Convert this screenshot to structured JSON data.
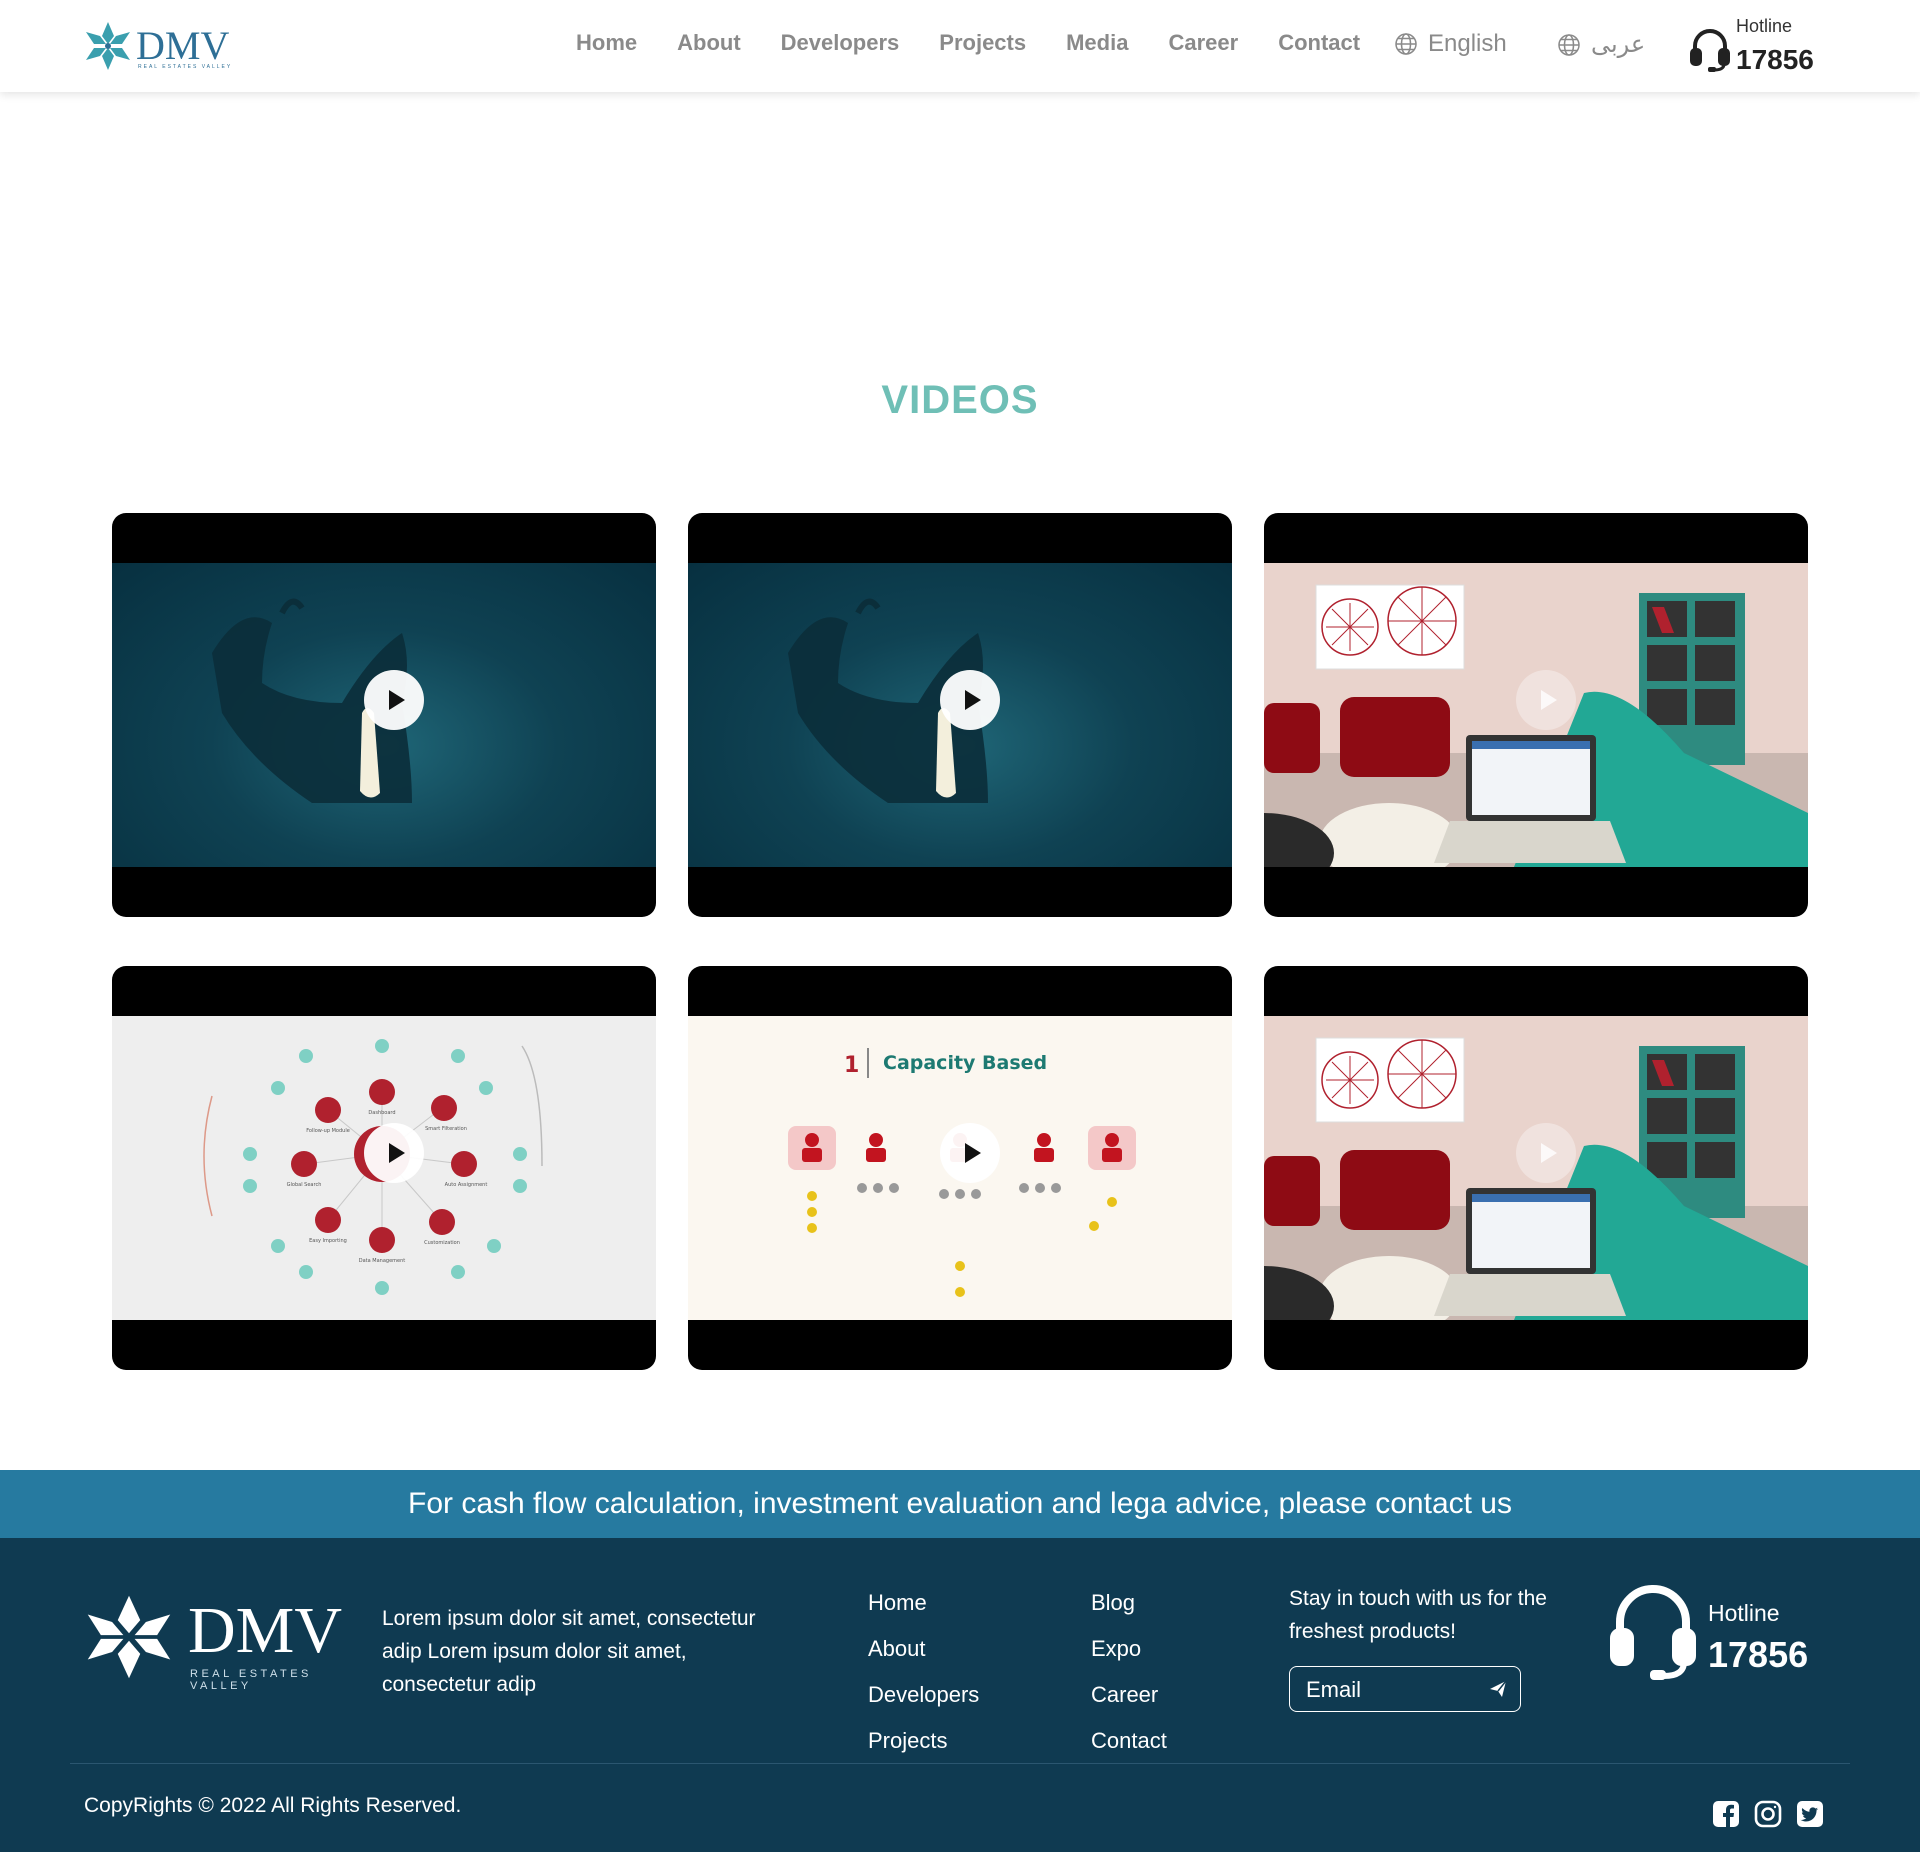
{
  "header": {
    "logo_text": "DMV",
    "logo_subtext": "REAL ESTATES VALLEY",
    "nav": [
      "Home",
      "About",
      "Developers",
      "Projects",
      "Media",
      "Career",
      "Contact"
    ],
    "lang_english": "English",
    "lang_arabic": "عربى",
    "hotline_label": "Hotline",
    "hotline_number": "17856"
  },
  "videos_section": {
    "title": "VIDEOS",
    "videos": [
      {
        "thumbnail": "dark-teal-silhouette"
      },
      {
        "thumbnail": "dark-teal-silhouette"
      },
      {
        "thumbnail": "living-room-laptop"
      },
      {
        "thumbnail": "crm-features-diagram",
        "labels": [
          "Dashboard",
          "Smart Filteration",
          "Auto Assignment",
          "Customization",
          "Data Management",
          "Easy Importing",
          "Global Search",
          "Follow-up Module"
        ]
      },
      {
        "thumbnail": "capacity-based",
        "caption_number": "1",
        "caption_text": "Capacity Based"
      },
      {
        "thumbnail": "living-room-laptop"
      }
    ]
  },
  "banner": {
    "text": "For cash flow calculation, investment evaluation and lega advice, please contact us"
  },
  "footer": {
    "logo_text": "DMV",
    "logo_subtext": "REAL ESTATES VALLEY",
    "description": "Lorem ipsum dolor sit amet, consectetur adip Lorem ipsum dolor sit amet, consectetur adip",
    "links_col1": [
      "Home",
      "About",
      "Developers",
      "Projects"
    ],
    "links_col2": [
      "Blog",
      "Expo",
      "Career",
      "Contact"
    ],
    "newsletter_text": "Stay in touch with us for the freshest products!",
    "email_placeholder": "Email",
    "hotline_label": "Hotline",
    "hotline_number": "17856",
    "copyright": "CopyRights © 2022 All Rights Reserved.",
    "social": [
      "facebook-icon",
      "instagram-icon",
      "twitter-icon"
    ]
  },
  "colors": {
    "brand_blue": "#2e6f96",
    "section_title": "#6fbfb6",
    "banner_bg": "#267aa0",
    "footer_bg": "#0f3a51"
  }
}
